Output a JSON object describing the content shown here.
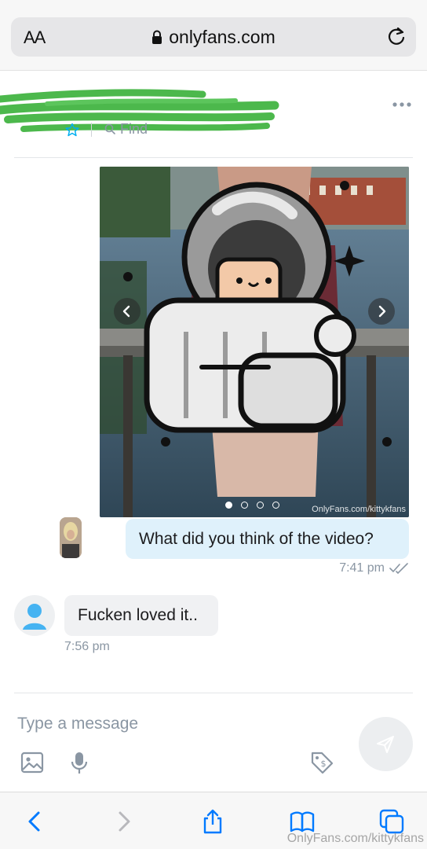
{
  "browser": {
    "text_size_label": "AA",
    "url": "onlyfans.com"
  },
  "chat_header": {
    "find_label": "Find"
  },
  "media": {
    "slide_count": 4,
    "active_slide": 1,
    "watermark": "OnlyFans.com/kittykfans"
  },
  "messages": [
    {
      "direction": "outgoing",
      "text": "What did you think of the video?",
      "time": "7:41 pm",
      "read": true
    },
    {
      "direction": "incoming",
      "text": "Fucken loved it..",
      "time": "7:56 pm"
    }
  ],
  "composer": {
    "placeholder": "Type a message"
  },
  "page_watermark": "OnlyFans.com/kittykfans",
  "colors": {
    "accent": "#00aff0",
    "outgoing_bubble": "#dff1fb",
    "incoming_bubble": "#f0f1f3",
    "muted_text": "#8a96a3",
    "redaction_scribble": "#4cb84c",
    "ios_blue": "#007aff"
  },
  "icons": {
    "lock": "lock-icon",
    "reload": "reload-icon",
    "more": "more-icon",
    "star": "star-icon",
    "find": "search-icon",
    "send": "send-icon",
    "image": "image-icon",
    "mic": "microphone-icon",
    "price": "price-tag-icon",
    "back": "chevron-left-icon",
    "forward": "chevron-right-icon",
    "share": "share-icon",
    "bookmarks": "book-icon",
    "tabs": "tabs-icon"
  }
}
